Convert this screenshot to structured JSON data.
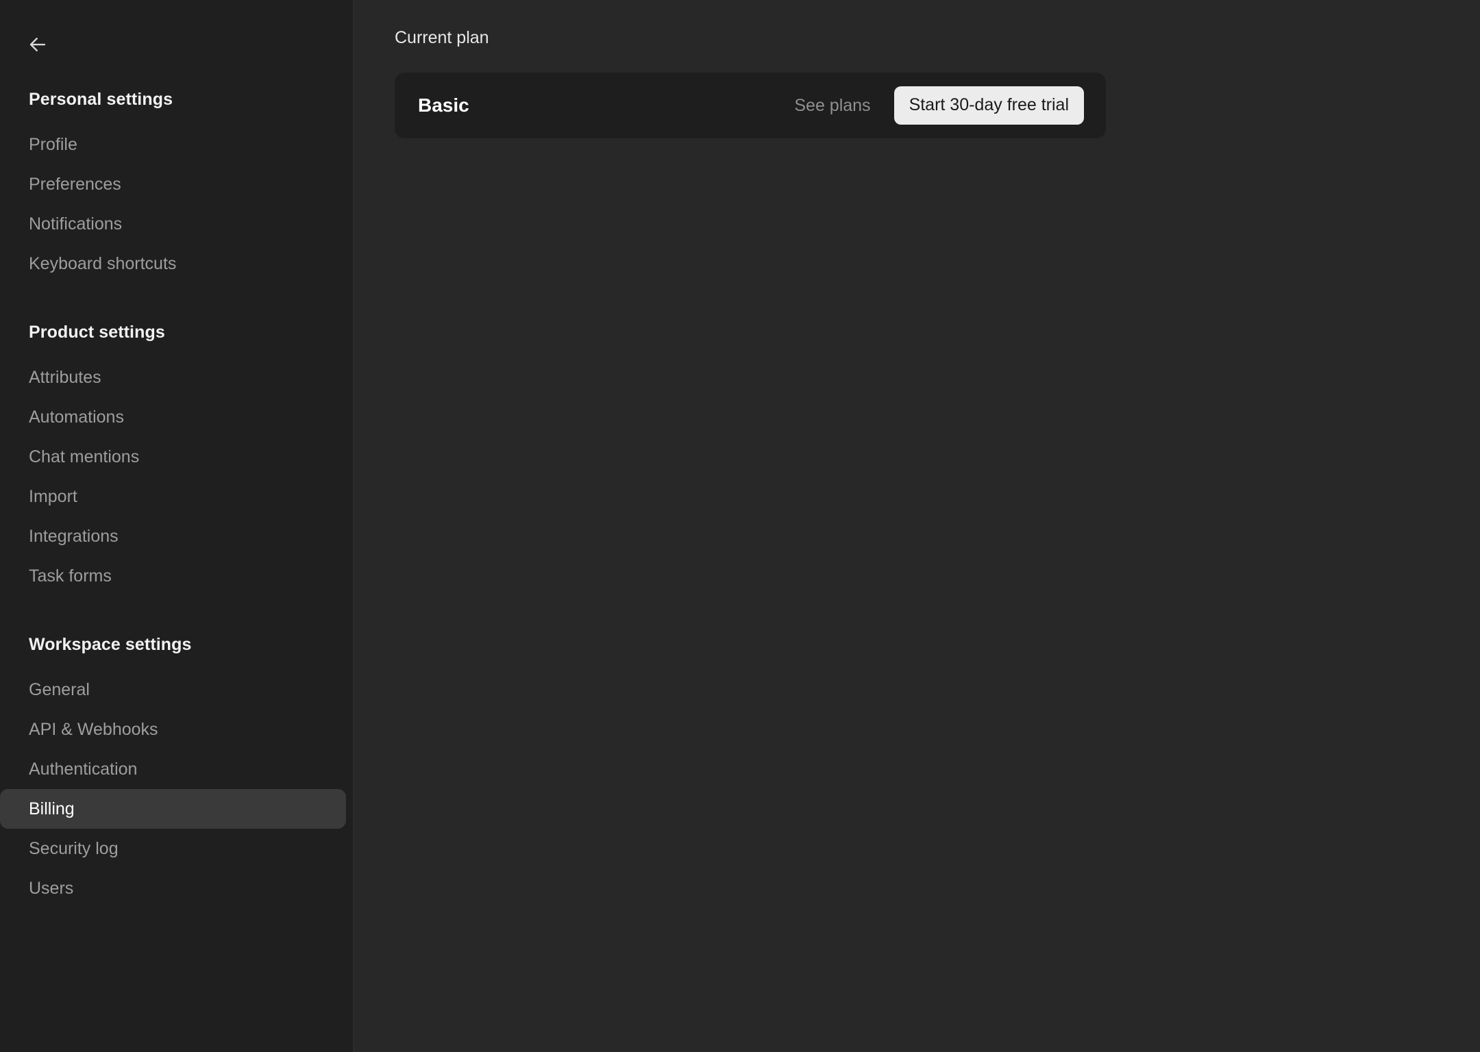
{
  "sidebar": {
    "back_icon": "arrow-left-icon",
    "sections": [
      {
        "title": "Personal settings",
        "items": [
          {
            "label": "Profile",
            "active": false
          },
          {
            "label": "Preferences",
            "active": false
          },
          {
            "label": "Notifications",
            "active": false
          },
          {
            "label": "Keyboard shortcuts",
            "active": false
          }
        ]
      },
      {
        "title": "Product settings",
        "items": [
          {
            "label": "Attributes",
            "active": false
          },
          {
            "label": "Automations",
            "active": false
          },
          {
            "label": "Chat mentions",
            "active": false
          },
          {
            "label": "Import",
            "active": false
          },
          {
            "label": "Integrations",
            "active": false
          },
          {
            "label": "Task forms",
            "active": false
          }
        ]
      },
      {
        "title": "Workspace settings",
        "items": [
          {
            "label": "General",
            "active": false
          },
          {
            "label": "API & Webhooks",
            "active": false
          },
          {
            "label": "Authentication",
            "active": false
          },
          {
            "label": "Billing",
            "active": true
          },
          {
            "label": "Security log",
            "active": false
          },
          {
            "label": "Users",
            "active": false
          }
        ]
      }
    ]
  },
  "main": {
    "heading": "Current plan",
    "plan_card": {
      "plan_name": "Basic",
      "see_plans_label": "See plans",
      "trial_button_label": "Start 30-day free trial"
    }
  },
  "colors": {
    "sidebar_bg": "#1f1f1f",
    "main_bg": "#282828",
    "card_bg": "#1e1e1e",
    "active_item_bg": "#3a3a3a",
    "muted_text": "#9e9e9e",
    "primary_text": "#ffffff",
    "button_bg": "#ececec",
    "button_text": "#1b1b1b"
  }
}
